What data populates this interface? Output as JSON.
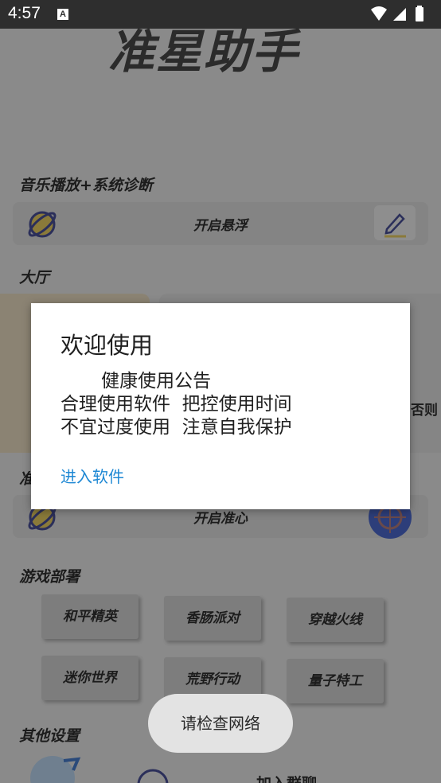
{
  "status_bar": {
    "time": "4:57",
    "notification_icon_letter": "A"
  },
  "app": {
    "title": "准星助手",
    "music_section": {
      "title": "音乐播放+系统诊断",
      "button_label": "开启悬浮"
    },
    "lobby_section": {
      "title": "大厅",
      "side_text": "否则"
    },
    "crosshair_section": {
      "title": "准",
      "button_label": "开启准心"
    },
    "game_section": {
      "title": "游戏部署",
      "games": [
        "和平精英",
        "香肠派对",
        "穿越火线",
        "迷你世界",
        "荒野行动",
        "量子特工"
      ]
    },
    "other_section": {
      "title": "其他设置",
      "item_label": "加入群聊"
    }
  },
  "dialog": {
    "title": "欢迎使用",
    "body_line1": "       健康使用公告",
    "body_line2": "合理使用软件  把控使用时间",
    "body_line3": "不宜过度使用  注意自我保护",
    "enter_link": "进入软件"
  },
  "toast": {
    "text": "请检查网络"
  },
  "colors": {
    "accent_link": "#1e88d4",
    "dialog_bg": "#ffffff",
    "scrim": "#7b7b7b"
  }
}
